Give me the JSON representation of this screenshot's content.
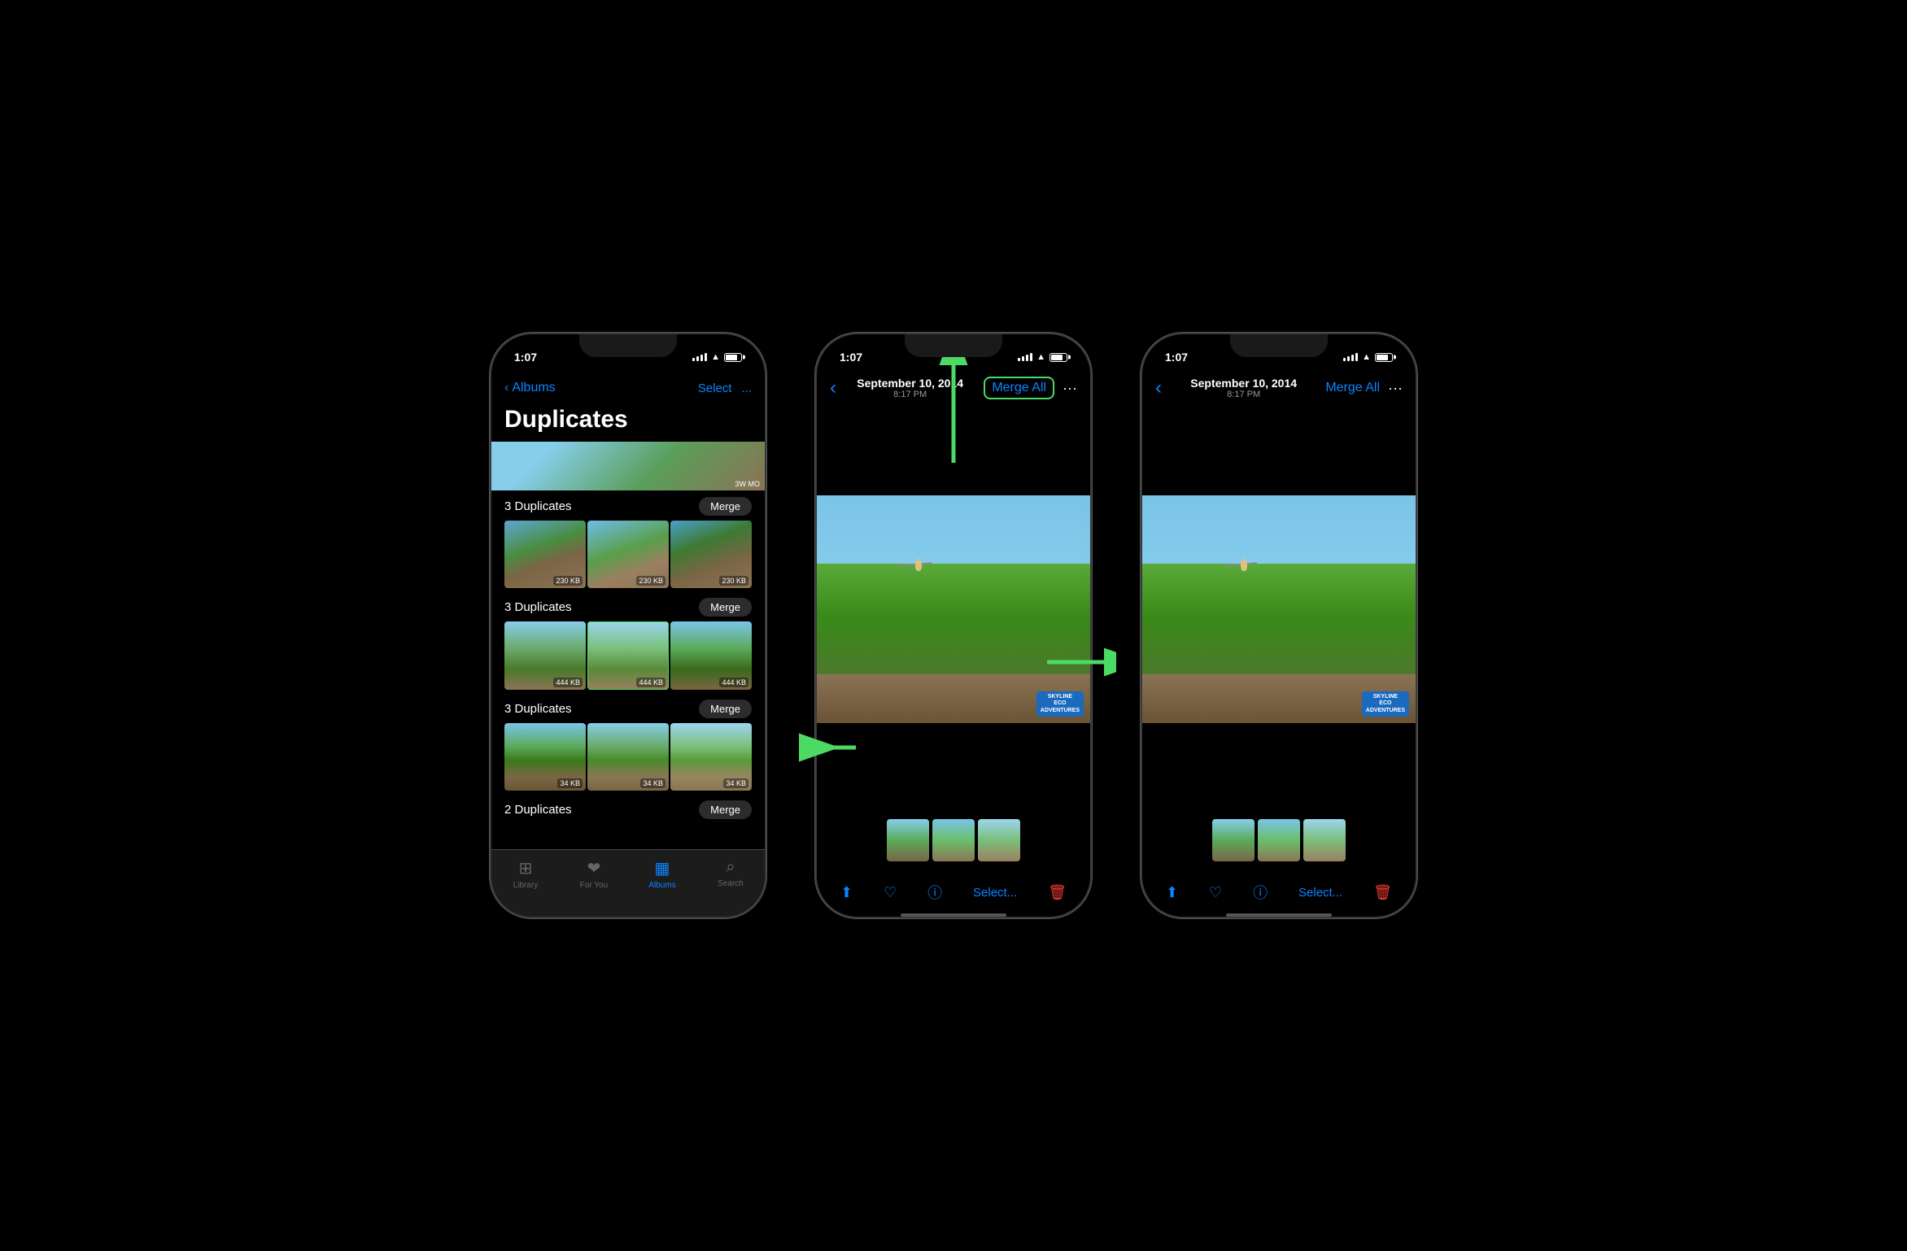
{
  "page": {
    "background": "#000000"
  },
  "phone1": {
    "status_time": "1:07",
    "nav": {
      "back_label": "Albums",
      "select_label": "Select",
      "more_label": "..."
    },
    "title": "Duplicates",
    "groups": [
      {
        "id": "group1",
        "label": "3 Duplicates",
        "merge_label": "Merge",
        "photos": [
          {
            "size": "230 KB",
            "type": "sim-photo-1"
          },
          {
            "size": "230 KB",
            "type": "sim-photo-2"
          },
          {
            "size": "230 KB",
            "type": "sim-photo-3"
          }
        ]
      },
      {
        "id": "group2",
        "label": "3 Duplicates",
        "merge_label": "Merge",
        "highlighted": true,
        "photos": [
          {
            "size": "444 KB",
            "type": "sim-photo-zip1"
          },
          {
            "size": "444 KB",
            "type": "sim-photo-zip2",
            "highlighted": true
          },
          {
            "size": "444 KB",
            "type": "sim-photo-zip3"
          }
        ]
      },
      {
        "id": "group3",
        "label": "3 Duplicates",
        "merge_label": "Merge",
        "photos": [
          {
            "size": "34 KB",
            "type": "sim-photo-zip1"
          },
          {
            "size": "34 KB",
            "type": "sim-photo-zip2"
          },
          {
            "size": "34 KB",
            "type": "sim-photo-zip3"
          }
        ]
      },
      {
        "id": "group4",
        "label": "2 Duplicates",
        "merge_label": "Merge",
        "photos": []
      }
    ],
    "tabs": [
      {
        "label": "Library",
        "icon": "▣",
        "active": false
      },
      {
        "label": "For You",
        "icon": "♡",
        "active": false
      },
      {
        "label": "Albums",
        "icon": "▦",
        "active": true
      },
      {
        "label": "Search",
        "icon": "⌕",
        "active": false
      }
    ]
  },
  "phone2": {
    "status_time": "1:07",
    "nav": {
      "back_icon": "‹",
      "date": "September 10, 2014",
      "time": "8:17 PM",
      "merge_all_label": "Merge All",
      "more_icon": "···",
      "merge_highlighted": true
    },
    "has_arrows": true,
    "arrow_up_label": "up arrow",
    "arrow_right_label": "right arrow",
    "arrow_left_label": "left arrow",
    "filmstrip": [
      "film-sim-1",
      "film-sim-2",
      "film-sim-3"
    ],
    "toolbar": {
      "share_icon": "↑",
      "heart_icon": "♡",
      "info_icon": "ⓘ",
      "select_label": "Select...",
      "delete_icon": "🗑"
    }
  },
  "phone3": {
    "status_time": "1:07",
    "nav": {
      "back_icon": "‹",
      "date": "September 10, 2014",
      "time": "8:17 PM",
      "merge_all_label": "Merge All",
      "more_icon": "···"
    },
    "filmstrip": [
      "film-sim-1",
      "film-sim-2",
      "film-sim-3"
    ],
    "toolbar": {
      "share_icon": "↑",
      "heart_icon": "♡",
      "info_icon": "ⓘ",
      "select_label": "Select...",
      "delete_icon": "🗑"
    }
  }
}
